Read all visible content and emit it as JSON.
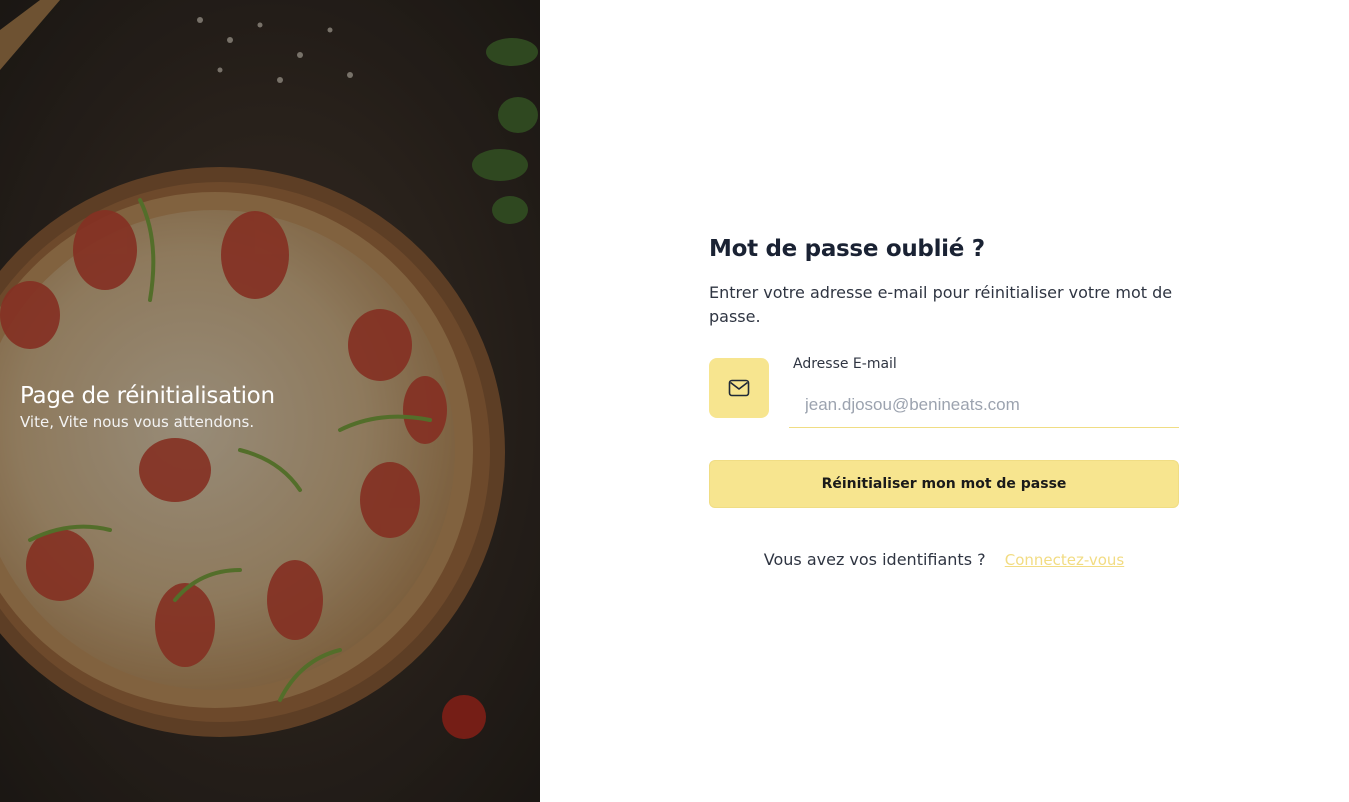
{
  "hero": {
    "title": "Page de réinitialisation",
    "subtitle": "Vite, Vite nous vous attendons."
  },
  "form": {
    "title": "Mot de passe oublié ?",
    "description": "Entrer votre adresse e-mail pour réinitialiser votre mot de passe.",
    "email_label": "Adresse E-mail",
    "email_placeholder": "jean.djosou@benineats.com",
    "submit_label": "Réinitialiser mon mot de passe",
    "login_prompt": "Vous avez vos identifiants ?",
    "login_link": "Connectez-vous"
  },
  "icons": {
    "email": "mail-icon"
  },
  "colors": {
    "accent": "#f7e58f",
    "link": "#f2dc83",
    "heading": "#1a2233"
  }
}
